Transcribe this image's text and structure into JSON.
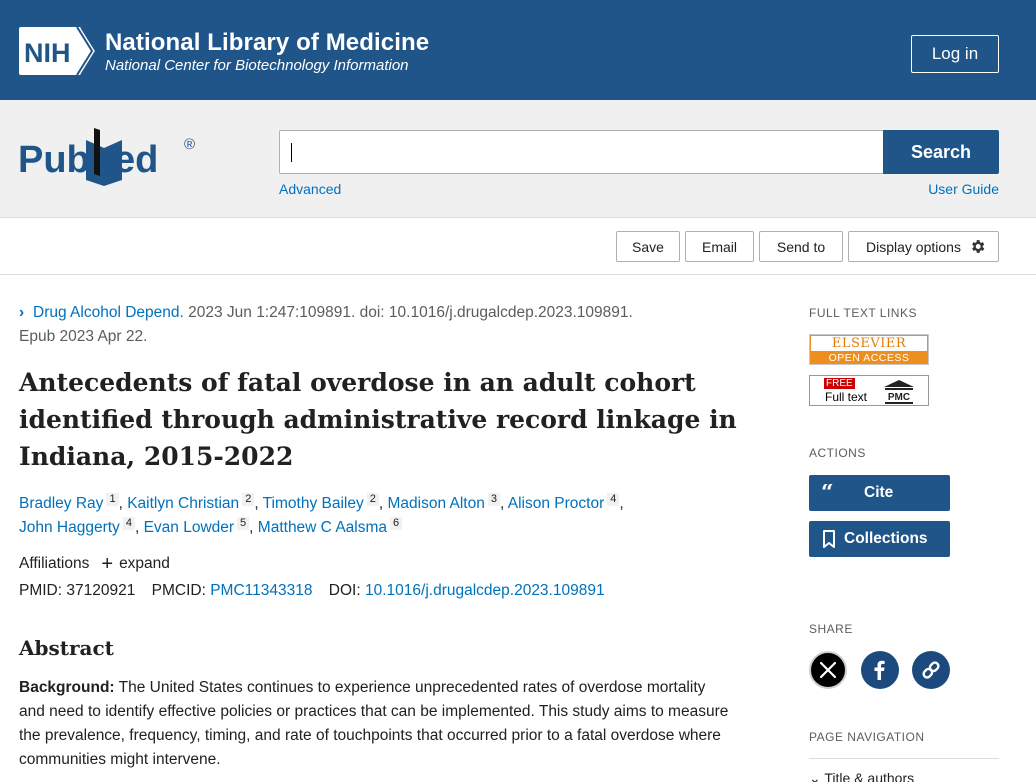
{
  "nih": {
    "badge_text": "NIH",
    "title": "National Library of Medicine",
    "subtitle": "National Center for Biotechnology Information",
    "login_label": "Log in"
  },
  "search": {
    "logo_text": "PubMed",
    "value": "",
    "button_label": "Search",
    "advanced_label": "Advanced",
    "user_guide_label": "User Guide"
  },
  "toolbar": {
    "save_label": "Save",
    "email_label": "Email",
    "send_to_label": "Send to",
    "display_options_label": "Display options"
  },
  "article": {
    "journal": "Drug Alcohol Depend.",
    "citation": " 2023 Jun 1:247:109891. doi: 10.1016/j.drugalcdep.2023.109891.",
    "epub": "Epub 2023 Apr 22.",
    "title": "Antecedents of fatal overdose in an adult cohort identified through administrative record linkage in Indiana, 2015-2022",
    "authors": [
      {
        "name": "Bradley Ray",
        "aff": "1"
      },
      {
        "name": "Kaitlyn Christian",
        "aff": "2"
      },
      {
        "name": "Timothy Bailey",
        "aff": "2"
      },
      {
        "name": "Madison Alton",
        "aff": "3"
      },
      {
        "name": "Alison Proctor",
        "aff": "4"
      },
      {
        "name": "John Haggerty",
        "aff": "4"
      },
      {
        "name": "Evan Lowder",
        "aff": "5"
      },
      {
        "name": "Matthew C Aalsma",
        "aff": "6"
      }
    ],
    "affiliations_label": "Affiliations",
    "expand_label": "expand",
    "pmid_label": "PMID:",
    "pmid": "37120921",
    "pmcid_label": "PMCID:",
    "pmcid": "PMC11343318",
    "doi_label": "DOI:",
    "doi": "10.1016/j.drugalcdep.2023.109891",
    "abstract_heading": "Abstract",
    "background_label": "Background:",
    "background_text": " The United States continues to experience unprecedented rates of overdose mortality and need to identify effective policies or practices that can be implemented. This study aims to measure the prevalence, frequency, timing, and rate of touchpoints that occurred prior to a fatal overdose where communities might intervene."
  },
  "sidebar": {
    "full_text_links_label": "FULL TEXT LINKS",
    "elsevier_top": "ELSEVIER",
    "elsevier_bottom": "OPEN ACCESS",
    "pmc_free": "FREE",
    "pmc_full_text": "Full text",
    "pmc_logo_text": "PMC",
    "actions_label": "ACTIONS",
    "cite_label": "Cite",
    "collections_label": "Collections",
    "share_label": "SHARE",
    "page_nav_label": "PAGE NAVIGATION",
    "page_nav_first": "Title & authors"
  },
  "colors": {
    "brand_blue": "#20558a",
    "link_blue": "#0071bc",
    "elsevier_orange": "#ee8e1d"
  }
}
